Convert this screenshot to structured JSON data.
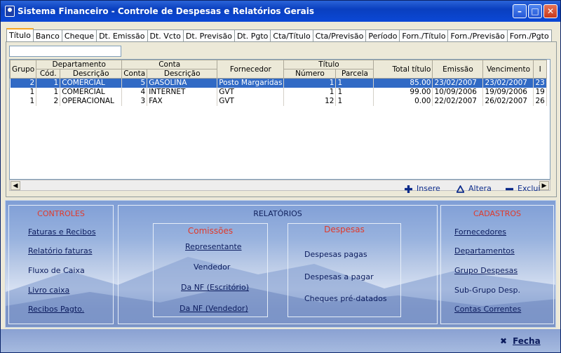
{
  "window": {
    "title": "Sistema Financeiro -  Controle de Despesas e Relatórios Gerais"
  },
  "tabs": [
    "Título",
    "Banco",
    "Cheque",
    "Dt. Emissão",
    "Dt. Vcto",
    "Dt. Previsão",
    "Dt. Pgto",
    "Cta/Título",
    "Cta/Previsão",
    "Período",
    "Forn./Título",
    "Forn./Previsão",
    "Forn./Pgto"
  ],
  "grid": {
    "headers": {
      "grupo": "Grupo",
      "departamento": "Departamento",
      "cod": "Cód.",
      "descricao": "Descrição",
      "conta_group": "Conta",
      "conta": "Conta",
      "conta_descricao": "Descrição",
      "fornecedor": "Fornecedor",
      "titulo": "Título",
      "numero": "Número",
      "parcela": "Parcela",
      "total_titulo": "Total título",
      "emissao": "Emissão",
      "vencimento": "Vencimento",
      "extra": "I"
    },
    "rows": [
      {
        "grupo": "2",
        "cod": "1",
        "desc": "COMERCIAL",
        "conta": "5",
        "conta_desc": "GASOLINA",
        "fornecedor": "Posto Margaridas",
        "numero": "1",
        "parcela": "1",
        "total": "85.00",
        "emissao": "23/02/2007",
        "vencimento": "23/02/2007",
        "extra": "23"
      },
      {
        "grupo": "1",
        "cod": "1",
        "desc": "COMERCIAL",
        "conta": "4",
        "conta_desc": "INTERNET",
        "fornecedor": "GVT",
        "numero": "1",
        "parcela": "1",
        "total": "99.00",
        "emissao": "10/09/2006",
        "vencimento": "19/09/2006",
        "extra": "19"
      },
      {
        "grupo": "1",
        "cod": "2",
        "desc": "OPERACIONAL",
        "conta": "3",
        "conta_desc": "FAX",
        "fornecedor": "GVT",
        "numero": "12",
        "parcela": "1",
        "total": "0.00",
        "emissao": "22/02/2007",
        "vencimento": "26/02/2007",
        "extra": "26"
      }
    ]
  },
  "actions": {
    "insert": "Insere",
    "edit": "Altera",
    "delete": "Exclui"
  },
  "controles": {
    "title": "CONTROLES",
    "items": [
      "Faturas e Recibos",
      "Relatório faturas",
      "Fluxo de Caixa",
      "Livro caixa",
      "Recibos Pagto."
    ]
  },
  "relatorios": {
    "title": "RELATÓRIOS",
    "comissoes": {
      "title": "Comissões",
      "items": [
        "Representante",
        "Vendedor",
        "Da NF (Escritório)",
        "Da NF (Vendedor)"
      ]
    },
    "despesas": {
      "title": "Despesas",
      "items": [
        "Despesas pagas",
        "Despesas a pagar",
        "Cheques pré-datados"
      ]
    }
  },
  "cadastros": {
    "title": "CADASTROS",
    "items": [
      "Fornecedores",
      "Departamentos",
      "Grupo Despesas",
      "Sub-Grupo Desp.",
      "Contas Correntes"
    ]
  },
  "footer": {
    "close": "Fecha"
  },
  "colors": {
    "title_red": "#e03a2a",
    "selection": "#316ac5",
    "titlebar": "#0a3fbf"
  }
}
